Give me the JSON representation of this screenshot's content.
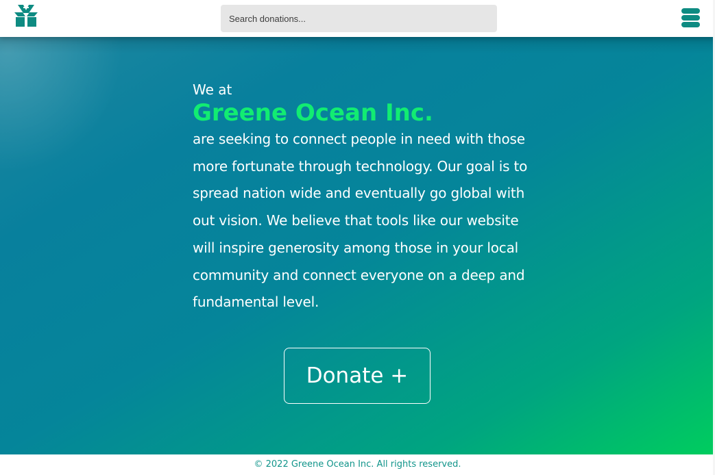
{
  "header": {
    "logo_icon": "gift-box-icon",
    "search_placeholder": "Search donations...",
    "menu_icon": "hamburger-menu-icon"
  },
  "hero": {
    "intro": "We at",
    "company": "Greene Ocean Inc.",
    "mission": "are seeking to connect people in need with those more fortunate through technology. Our goal is to spread nation wide and eventually go global with out vision. We believe that tools like our website will inspire generosity among those in your local community and connect everyone on a deep and fundamental level.",
    "donate_label": "Donate +"
  },
  "footer": {
    "copyright": "© 2022 Greene Ocean Inc. All rights reserved."
  },
  "colors": {
    "brand_teal": "#0e8b82",
    "accent_green": "#12ec72",
    "gradient_start": "#08809d",
    "gradient_end": "#00cd5e"
  }
}
